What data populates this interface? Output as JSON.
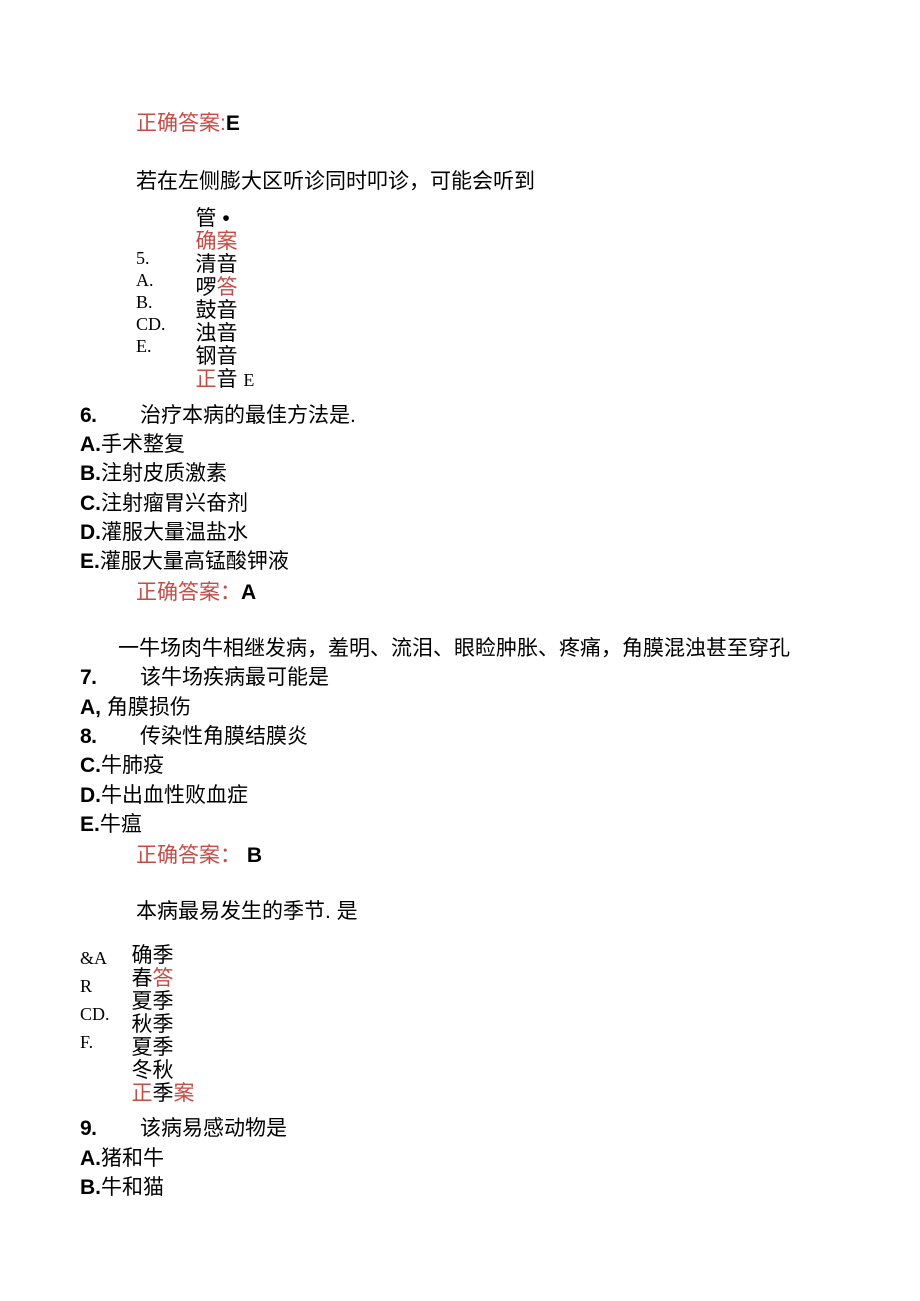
{
  "answers": {
    "a_e": {
      "label": "正确答案:",
      "value": "E"
    },
    "a_a": {
      "label": "正确答案：",
      "value": "A"
    },
    "a_b": {
      "label": "正确答案：",
      "value": "B"
    }
  },
  "q5": {
    "stem": "若在左侧膨大区听诊同时叩诊，可能会听到",
    "vertLabels": [
      "5.",
      "A.",
      "B.",
      "CD.",
      "E."
    ],
    "vertTexts": [
      {
        "cls": "",
        "t": "管 •"
      },
      {
        "cls": "red",
        "t": "确案"
      },
      {
        "cls": "",
        "t": "清音"
      },
      {
        "cls": "red-mix",
        "t": "啰答"
      },
      {
        "cls": "",
        "t": "鼓音"
      },
      {
        "cls": "",
        "t": "浊音"
      },
      {
        "cls": "",
        "t": "钢音"
      },
      {
        "cls": "mix-red",
        "t": "正音 E"
      }
    ]
  },
  "q6": {
    "num": "6.",
    "stem": "治疗本病的最佳方法是.",
    "opts": [
      {
        "k": "A.",
        "v": "手术整复"
      },
      {
        "k": "B.",
        "v": "注射皮质激素"
      },
      {
        "k": "C.",
        "v": "注射瘤胃兴奋剂"
      },
      {
        "k": "D.",
        "v": "灌服大量温盐水"
      },
      {
        "k": "E.",
        "v": "灌服大量高锰酸钾液"
      }
    ]
  },
  "caseIntro": "一牛场肉牛相继发病，羞明、流泪、眼睑肿胀、疼痛，角膜混浊甚至穿孔",
  "q7": {
    "num": "7.",
    "stem": "该牛场疾病最可能是",
    "optA": {
      "k": "A,",
      "v": "角膜损伤"
    },
    "opt8num": "8.",
    "opt8text": "传染性角膜结膜炎",
    "opts": [
      {
        "k": "C.",
        "v": "牛肺疫"
      },
      {
        "k": "D.",
        "v": "牛出血性败血症"
      },
      {
        "k": "E.",
        "v": "牛瘟"
      }
    ]
  },
  "q8block": {
    "stem": "本病最易发生的季节. 是",
    "vertLabels": [
      "&A",
      "R",
      "CD.",
      "F."
    ],
    "vertTexts": [
      {
        "cls": "",
        "t": "确季"
      },
      {
        "cls": "red-mix2",
        "t": "春答"
      },
      {
        "cls": "",
        "t": "夏季"
      },
      {
        "cls": "",
        "t": "秋季"
      },
      {
        "cls": "",
        "t": "夏季"
      },
      {
        "cls": "",
        "t": "冬秋"
      },
      {
        "cls": "mix-red2",
        "t": "正季案"
      }
    ]
  },
  "q9": {
    "num": "9.",
    "stem": "该病易感动物是",
    "opts": [
      {
        "k": "A.",
        "v": "猪和牛"
      },
      {
        "k": "B.",
        "v": "牛和猫"
      }
    ]
  }
}
